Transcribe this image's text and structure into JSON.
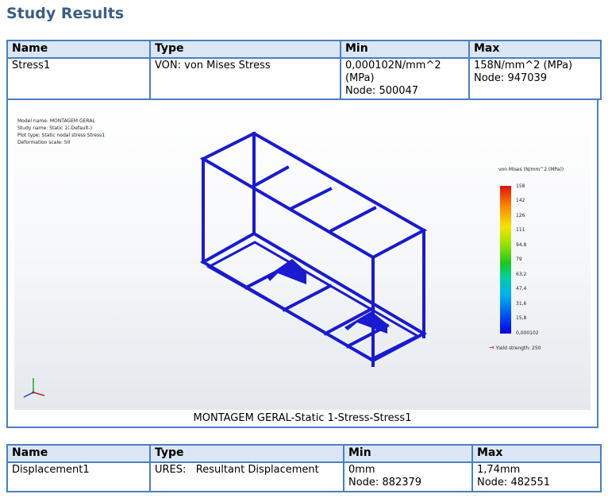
{
  "section_title": "Study Results",
  "headers": {
    "name": "Name",
    "type": "Type",
    "min": "Min",
    "max": "Max"
  },
  "stress": {
    "name": "Stress1",
    "type": "VON: von Mises Stress",
    "min_lines": [
      "0,000102N/mm^2",
      "(MPa)",
      "Node: 500047"
    ],
    "max_lines": [
      "158N/mm^2 (MPa)",
      "Node: 947039"
    ]
  },
  "plot": {
    "info_lines": [
      "Model name: MONTAGEM GERAL",
      "Study name: Static 1(-Default-)",
      "Plot type: Static nodal stress Stress1",
      "Deformation scale: 50"
    ],
    "legend_title": "von Mises (N/mm^2 (MPa))",
    "ticks": [
      "158",
      "142",
      "126",
      "111",
      "94,8",
      "79",
      "63,2",
      "47,4",
      "31,6",
      "15,8",
      "0,000102"
    ],
    "yield_label": "Yield strength: 250",
    "caption": "MONTAGEM GERAL-Static 1-Stress-Stress1",
    "colors": {
      "frame": "#1a1ad0",
      "table_border": "#4a7fc1",
      "header_bg": "#dbe6f4"
    }
  },
  "displacement": {
    "name": "Displacement1",
    "type": "URES:   Resultant Displacement",
    "min_lines": [
      "0mm",
      "Node: 882379"
    ],
    "max_lines": [
      "1,74mm",
      "Node: 482551"
    ]
  }
}
